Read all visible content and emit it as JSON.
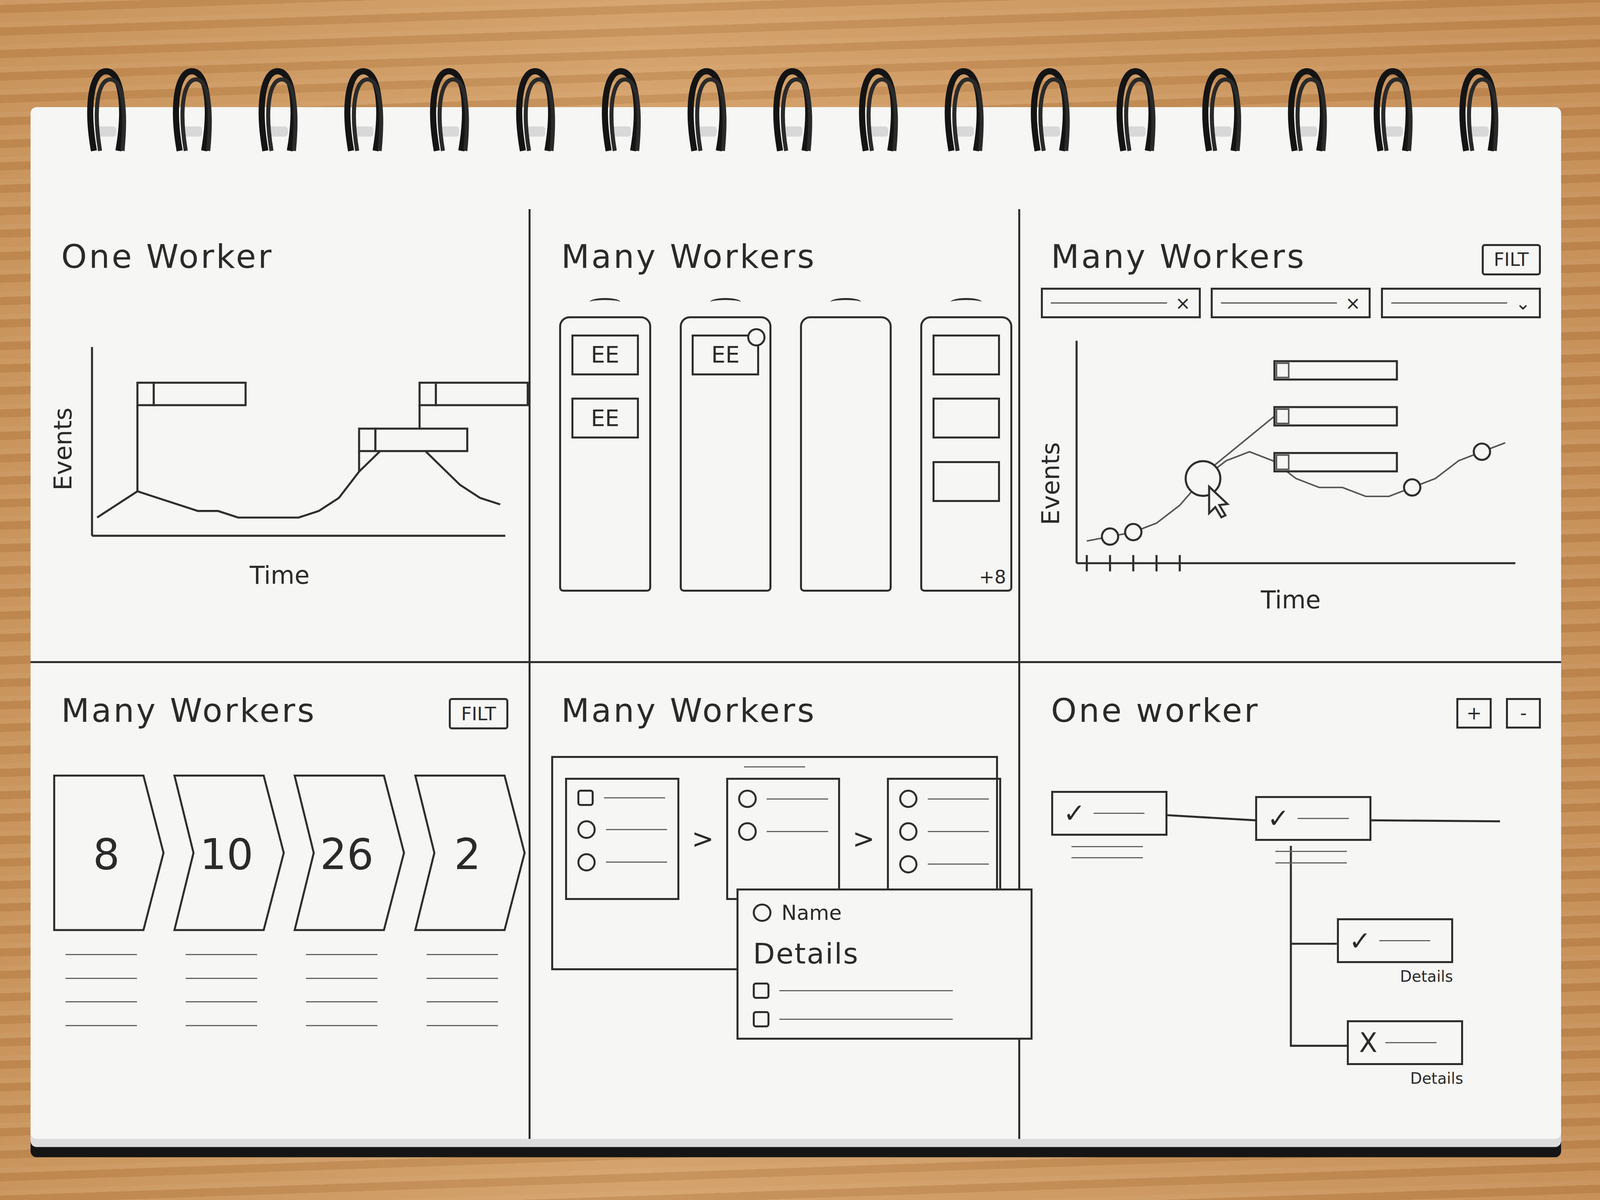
{
  "event_timeline": {
    "title": "One Worker",
    "y_label": "Events",
    "x_label": "Time",
    "series": [
      2,
      4,
      6,
      5,
      4,
      3,
      3,
      2,
      2,
      2,
      2,
      3,
      5,
      9,
      12,
      14,
      13,
      10,
      7,
      5,
      4
    ],
    "flags": [
      {
        "at": 2,
        "row": 0
      },
      {
        "at": 16,
        "row": 0
      },
      {
        "at": 13,
        "row": 1
      }
    ]
  },
  "worker_columns": {
    "title": "Many Workers",
    "columns": [
      {
        "cards": [
          {
            "label": "EE",
            "flagged": false
          },
          {
            "label": "EE",
            "flagged": false
          }
        ],
        "more": ""
      },
      {
        "cards": [
          {
            "label": "EE",
            "flagged": true
          }
        ],
        "more": ""
      },
      {
        "cards": [],
        "more": ""
      },
      {
        "cards": [
          {
            "label": "",
            "flagged": false
          },
          {
            "label": "",
            "flagged": false
          },
          {
            "label": "",
            "flagged": false
          }
        ],
        "more": "+8"
      }
    ]
  },
  "worker_chart": {
    "title": "Many Workers",
    "filter": "FILT",
    "chips": [
      {
        "icon": "×"
      },
      {
        "icon": "×"
      },
      {
        "icon": "⌄"
      }
    ],
    "y_label": "Events",
    "x_label": "Time",
    "series": [
      1,
      1.5,
      2,
      3,
      5,
      8,
      10,
      11,
      10,
      8,
      7,
      7,
      6,
      6,
      7,
      8,
      10,
      11,
      12
    ],
    "markers": [
      {
        "at": 1,
        "selected": false
      },
      {
        "at": 2,
        "selected": false
      },
      {
        "at": 5,
        "selected": true
      },
      {
        "at": 14,
        "selected": false
      },
      {
        "at": 17,
        "selected": false
      }
    ],
    "popup": [
      {
        "checked": false
      },
      {
        "checked": false
      },
      {
        "checked": false
      }
    ]
  },
  "pipeline": {
    "title": "Many Workers",
    "filter": "FILT",
    "stages": [
      {
        "count": "8"
      },
      {
        "count": "10"
      },
      {
        "count": "26"
      },
      {
        "count": "2"
      }
    ]
  },
  "selector": {
    "title": "Many Workers",
    "arrow": ">",
    "columns": [
      {
        "options": [
          {
            "kind": "checkbox"
          },
          {
            "kind": "radio"
          },
          {
            "kind": "radio"
          }
        ]
      },
      {
        "options": [
          {
            "kind": "radio"
          },
          {
            "kind": "radio"
          }
        ]
      },
      {
        "options": [
          {
            "kind": "radio"
          },
          {
            "kind": "radio"
          },
          {
            "kind": "radio"
          }
        ]
      }
    ],
    "popup": {
      "name": "Name",
      "heading": "Details",
      "options": [
        {
          "checked": false
        },
        {
          "checked": false
        }
      ]
    }
  },
  "worker_tree": {
    "title": "One worker",
    "buttons": [
      "+",
      "-"
    ],
    "nodes": [
      {
        "mark": "✓",
        "label": ""
      },
      {
        "mark": "✓",
        "label": ""
      },
      {
        "mark": "✓",
        "label": "Details"
      },
      {
        "mark": "X",
        "label": "Details"
      }
    ]
  }
}
